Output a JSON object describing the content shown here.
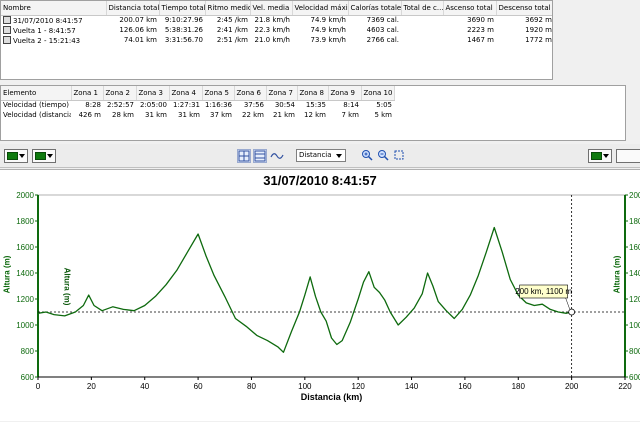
{
  "summary": {
    "columns": [
      "Nombre",
      "Distancia total",
      "Tiempo total",
      "Ritmo medio",
      "Vel. media",
      "Velocidad máxima",
      "Calorías totales",
      "Total de c...",
      "Ascenso total",
      "Descenso total"
    ],
    "rows": [
      [
        "31/07/2010 8:41:57",
        "200.07 km",
        "9:10:27.96",
        "2:45 /km",
        "21.8 km/h",
        "74.9 km/h",
        "7369 cal.",
        "",
        "3690 m",
        "3692 m"
      ],
      [
        "Vuelta 1 - 8:41:57",
        "126.06 km",
        "5:38:31.26",
        "2:41 /km",
        "22.3 km/h",
        "74.9 km/h",
        "4603 cal.",
        "",
        "2223 m",
        "1920 m"
      ],
      [
        "Vuelta 2 - 15:21:43",
        "74.01 km",
        "3:31:56.70",
        "2:51 /km",
        "21.0 km/h",
        "73.9 km/h",
        "2766 cal.",
        "",
        "1467 m",
        "1772 m"
      ]
    ]
  },
  "zones": {
    "columns": [
      "Elemento",
      "Zona 1",
      "Zona 2",
      "Zona 3",
      "Zona 4",
      "Zona 5",
      "Zona 6",
      "Zona 7",
      "Zona 8",
      "Zona 9",
      "Zona 10"
    ],
    "rows": [
      [
        "Velocidad (tiempo)",
        "8:28",
        "2:52:57",
        "2:05:00",
        "1:27:31",
        "1:16:36",
        "37:56",
        "30:54",
        "15:35",
        "8:14",
        "5:05"
      ],
      [
        "Velocidad (distancia)",
        "426 m",
        "28 km",
        "31 km",
        "31 km",
        "37 km",
        "22 km",
        "21 km",
        "12 km",
        "7 km",
        "5 km"
      ]
    ]
  },
  "toolbar": {
    "metric_select": "Distancia"
  },
  "colors": {
    "line": "#0e6a0e",
    "axis": "#0e6a0e",
    "box_bg": "#ffffcc"
  },
  "chart_data": {
    "type": "line",
    "title": "31/07/2010 8:41:57",
    "xlabel": "Distancia (km)",
    "ylabel": "Altura (m)",
    "xlim": [
      0,
      220
    ],
    "ylim": [
      600,
      2000
    ],
    "xticks": [
      "0",
      "20",
      "40",
      "60",
      "80",
      "100",
      "120",
      "140",
      "160",
      "180",
      "200",
      "220"
    ],
    "yticks": [
      "600",
      "800",
      "1000",
      "1200",
      "1400",
      "1600",
      "1800",
      "2000"
    ],
    "grid": false,
    "cursor": {
      "x": 200,
      "y": 1100,
      "label": "200 km, 1100 m"
    },
    "series": [
      {
        "x": [
          0,
          3,
          6,
          10,
          14,
          17,
          19,
          21,
          24,
          28,
          32,
          36,
          40,
          44,
          48,
          52,
          56,
          60,
          63,
          66,
          70,
          74,
          78,
          82,
          86,
          90,
          92,
          95,
          98,
          100,
          102,
          104,
          106,
          108,
          110,
          112,
          114,
          117,
          120,
          122,
          124,
          126,
          128,
          130,
          132,
          135,
          138,
          141,
          144,
          146,
          148,
          150,
          153,
          156,
          159,
          162,
          165,
          168,
          171,
          174,
          177,
          180,
          183,
          186,
          189,
          192,
          195,
          198,
          200
        ],
        "values": [
          1090,
          1100,
          1080,
          1070,
          1100,
          1150,
          1230,
          1150,
          1110,
          1140,
          1120,
          1110,
          1150,
          1220,
          1310,
          1420,
          1560,
          1700,
          1530,
          1380,
          1220,
          1050,
          990,
          920,
          880,
          830,
          790,
          950,
          1100,
          1230,
          1370,
          1220,
          1100,
          1030,
          900,
          850,
          880,
          1020,
          1200,
          1330,
          1410,
          1290,
          1250,
          1190,
          1100,
          1000,
          1060,
          1130,
          1240,
          1400,
          1300,
          1180,
          1110,
          1050,
          1120,
          1230,
          1380,
          1560,
          1750,
          1560,
          1350,
          1230,
          1170,
          1150,
          1160,
          1120,
          1100,
          1090,
          1100
        ]
      }
    ]
  }
}
